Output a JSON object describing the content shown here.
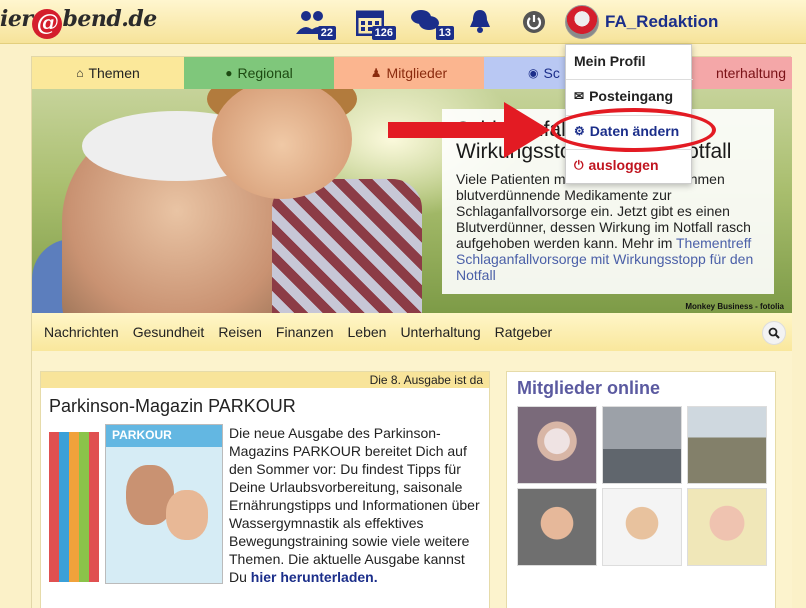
{
  "header": {
    "logo_prefix": "ier",
    "logo_at": "@",
    "logo_suffix": "bend.de",
    "badges": {
      "members": "22",
      "calendar": "126",
      "messages": "13"
    },
    "username": "FA_Redaktion"
  },
  "user_menu": {
    "profile": "Mein Profil",
    "inbox": "Posteingang",
    "edit": "Daten ändern",
    "logout": "ausloggen"
  },
  "tabs": [
    {
      "label": "Themen",
      "icon": "home-icon"
    },
    {
      "label": "Regional",
      "icon": "globe-icon"
    },
    {
      "label": "Mitglieder",
      "icon": "user-icon"
    },
    {
      "label": "Sc",
      "icon": "eye-icon"
    },
    {
      "label": "nterhaltung",
      "icon": ""
    }
  ],
  "hero": {
    "title": "Schlaganfallvorsorge mit Wirkungsstopp für den Notfall",
    "text": "Viele Patienten mit Vorhofflimmern nehmen blutverdünnende Medikamente zur Schlaganfallvorsorge ein. Jetzt gibt es einen Blutverdünner, dessen Wirkung im Notfall rasch aufgehoben werden kann. Mehr im",
    "link": "Thementreff Schlaganfallvorsorge mit Wirkungsstopp für den Notfall",
    "credit": "Monkey Business - fotolia"
  },
  "subnav": [
    "Nachrichten",
    "Gesundheit",
    "Reisen",
    "Finanzen",
    "Leben",
    "Unterhaltung",
    "Ratgeber"
  ],
  "article": {
    "head": "Die 8. Ausgabe ist da",
    "title": "Parkinson-Magazin PARKOUR",
    "magazine_title": "PARKOUR",
    "text": "Die neue Ausgabe des Parkinson-Magazins PARKOUR bereitet Dich auf den Sommer vor: Du findest Tipps für Deine Urlaubsvorbereitung, saisonale Ernährungstipps und Informationen über Wassergymnastik als effektives Bewegungstraining sowie viele weitere Themen. Die aktuelle Ausgabe kannst Du",
    "link": "hier herunterladen."
  },
  "sidebar": {
    "title": "Mitglieder online"
  },
  "colors": {
    "accent": "#1b2e8a",
    "alert": "#e31b23",
    "header_bg": "#f6e39a"
  }
}
